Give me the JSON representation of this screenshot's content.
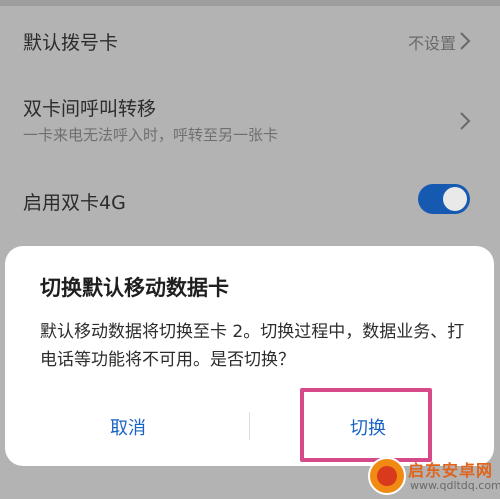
{
  "settings": {
    "default_dial": {
      "title": "默认拨号卡",
      "value": "不设置"
    },
    "call_forward": {
      "title": "双卡间呼叫转移",
      "subtitle": "一卡来电无法呼入时，呼转至另一张卡"
    },
    "dual_4g": {
      "title": "启用双卡4G",
      "enabled": true
    }
  },
  "dialog": {
    "title": "切换默认移动数据卡",
    "message": "默认移动数据将切换至卡 2。切换过程中，数据业务、打电话等功能将不可用。是否切换？",
    "cancel_label": "取消",
    "confirm_label": "切换"
  },
  "watermark": {
    "name": "启东安卓网",
    "url": "www.qdltdq.com"
  },
  "colors": {
    "accent": "#1a63c6",
    "toggle_on": "#1659b0",
    "highlight": "#d64a8a",
    "dim_background": "#b3b3b3"
  }
}
